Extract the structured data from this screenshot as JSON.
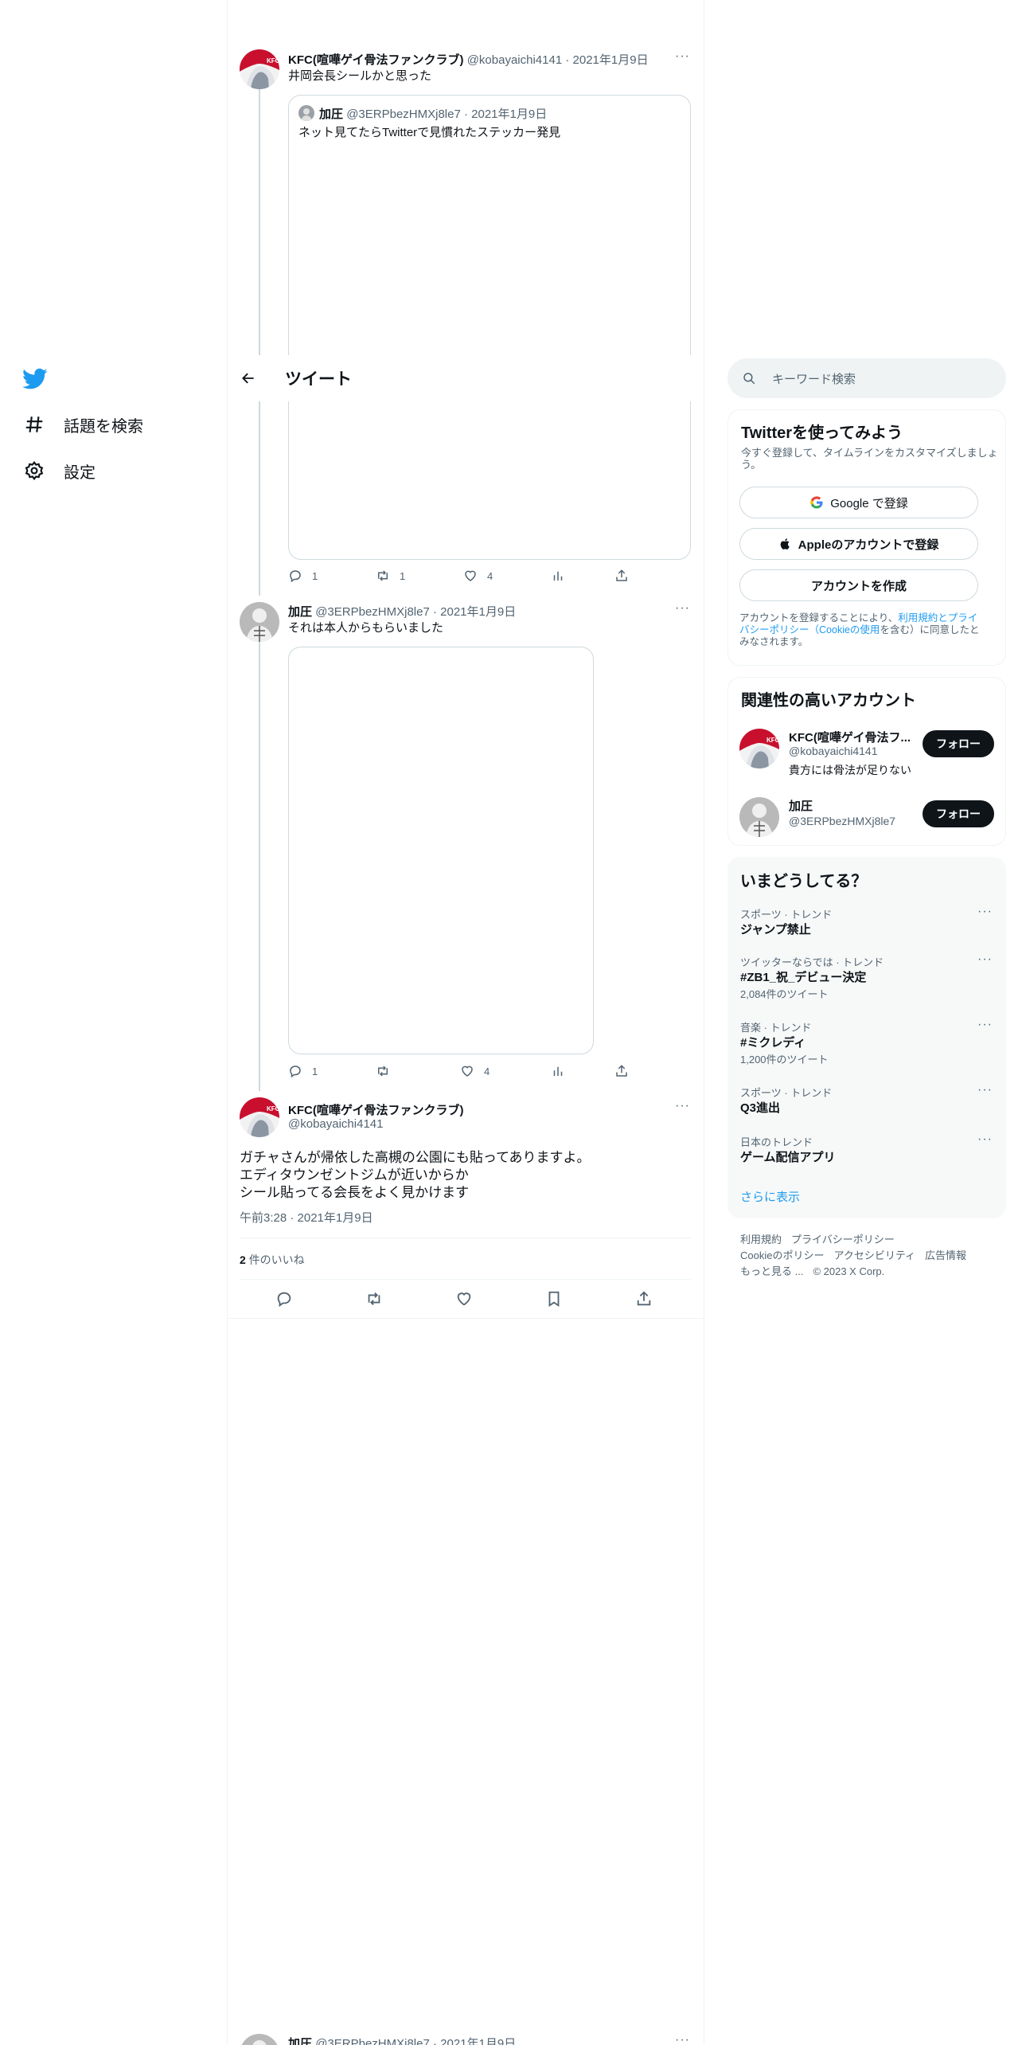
{
  "colors": {
    "brand": "#1d9bf0",
    "text": "#0f1419",
    "muted": "#536471",
    "border": "#cfd9de",
    "button_dark": "#0f1419"
  },
  "nav": {
    "logo_icon": "twitter-bird-icon",
    "items": [
      {
        "label": "話題を検索",
        "icon": "hashtag-icon"
      },
      {
        "label": "設定",
        "icon": "gear-icon"
      }
    ]
  },
  "header": {
    "back_icon": "arrow-left-icon",
    "title": "ツイート"
  },
  "tweets": [
    {
      "name": "KFC(喧嘩ゲイ骨法ファンクラブ)",
      "handle": "@kobayaichi4141",
      "dot": "·",
      "date": "2021年1月9日",
      "text": "井岡会長シールかと思った",
      "quote": {
        "name": "加圧",
        "handle": "@3ERPbezHMXj8le7",
        "dot": "·",
        "date": "2021年1月9日",
        "text": "ネット見てたらTwitterで見慣れたステッカー発見"
      },
      "replies": "1",
      "retweets": "1",
      "likes": "4"
    },
    {
      "name": "加圧",
      "handle": "@3ERPbezHMXj8le7",
      "dot": "·",
      "date": "2021年1月9日",
      "text": "それは本人からもらいました",
      "replies": "1",
      "retweets": "",
      "likes": "4"
    }
  ],
  "main_tweet": {
    "name": "KFC(喧嘩ゲイ骨法ファンクラブ)",
    "handle": "@kobayaichi4141",
    "lines": [
      "ガチャさんが帰依した高槻の公園にも貼ってありますよ。",
      "エディタウンゼントジムが近いからか",
      "シール貼ってる会長をよく見かけます"
    ],
    "timestamp": "午前3:28 · 2021年1月9日",
    "likes_count": "2",
    "likes_label": "件のいいね"
  },
  "bottom_tweet": {
    "name": "加圧",
    "handle": "@3ERPbezHMXj8le7",
    "dot": "·",
    "date": "2021年1月9日"
  },
  "search": {
    "placeholder": "キーワード検索"
  },
  "signup": {
    "title": "Twitterを使ってみよう",
    "subtitle_1": "今すぐ登録して、タイムラインをカスタマイズしましょ",
    "subtitle_2": "う。",
    "google_label": "Google で登録",
    "apple_label": "Appleのアカウントで登録",
    "create_label": "アカウントを作成",
    "legal_1a": "アカウントを登録することにより、",
    "legal_1b": "利用規約",
    "legal_1c": "とプライ",
    "legal_2a": "バシーポリシー（",
    "legal_2b": "Cookieの使用",
    "legal_2c": "を含む）に同意したと",
    "legal_3": "みなされます。"
  },
  "related": {
    "title": "関連性の高いアカウント",
    "accounts": [
      {
        "name": "KFC(喧嘩ゲイ骨法フ...",
        "handle": "@kobayaichi4141",
        "bio": "貴方には骨法が足りない",
        "follow": "フォロー"
      },
      {
        "name": "加圧",
        "handle": "@3ERPbezHMXj8le7",
        "bio": "",
        "follow": "フォロー"
      }
    ]
  },
  "trends": {
    "title": "いまどうしてる？",
    "items": [
      {
        "meta": "スポーツ · トレンド",
        "name": "ジャンプ禁止",
        "count": ""
      },
      {
        "meta": "ツイッターならでは · トレンド",
        "name": "#ZB1_祝_デビュー決定",
        "count": "2,084件のツイート"
      },
      {
        "meta": "音楽 · トレンド",
        "name": "#ミクレディ",
        "count": "1,200件のツイート"
      },
      {
        "meta": "スポーツ · トレンド",
        "name": "Q3進出",
        "count": ""
      },
      {
        "meta": "日本のトレンド",
        "name": "ゲーム配信アプリ",
        "count": ""
      }
    ],
    "show_more": "さらに表示"
  },
  "footer": {
    "links_1": [
      "利用規約",
      "プライバシーポリシー"
    ],
    "links_2": [
      "Cookieのポリシー",
      "アクセシビリティ",
      "広告情報"
    ],
    "more": "もっと見る ...",
    "copyright": "© 2023 X Corp."
  }
}
